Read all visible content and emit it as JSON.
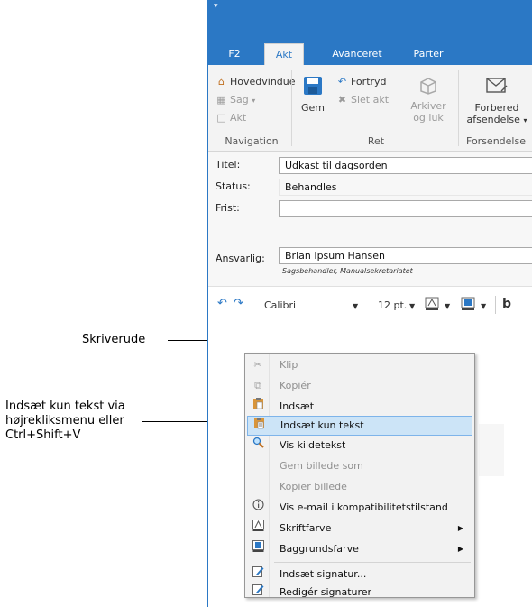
{
  "annotations": {
    "editor_label": "Skriverude",
    "paste_text_line1": "Indsæt kun tekst via",
    "paste_text_line2": "højrekliksmenu eller",
    "paste_text_line3": "Ctrl+Shift+V"
  },
  "tabs": [
    {
      "label": "F2",
      "active": false
    },
    {
      "label": "Akt",
      "active": true
    },
    {
      "label": "Avanceret",
      "active": false
    },
    {
      "label": "Parter",
      "active": false
    }
  ],
  "ribbon": {
    "navigation": {
      "items": [
        "Hovedvindue",
        "Sag",
        "Akt"
      ],
      "group_label": "Navigation"
    },
    "ret": {
      "save_line1": "Gem",
      "undo": "Fortryd",
      "delete": "Slet akt",
      "archive_line1": "Arkiver",
      "archive_line2": "og luk",
      "group_label": "Ret"
    },
    "send": {
      "prepare_line1": "Forbered",
      "prepare_line2": "afsendelse",
      "group_label": "Forsendelse"
    }
  },
  "form": {
    "title_label": "Titel:",
    "title_value": "Udkast til dagsorden",
    "status_label": "Status:",
    "status_value": "Behandles",
    "deadline_label": "Frist:",
    "deadline_value": "",
    "responsible_label": "Ansvarlig:",
    "responsible_value": "Brian Ipsum Hansen",
    "responsible_sub": "Sagsbehandler, Manualsekretariatet"
  },
  "format_toolbar": {
    "font": "Calibri",
    "size": "12 pt.",
    "bold": "b"
  },
  "context_menu": {
    "items": [
      {
        "label": "Klip",
        "enabled": false,
        "icon": "scissors-icon"
      },
      {
        "label": "Kopiér",
        "enabled": false,
        "icon": "copy-icon"
      },
      {
        "label": "Indsæt",
        "enabled": true,
        "icon": "paste-icon"
      },
      {
        "label": "Indsæt kun tekst",
        "enabled": true,
        "highlighted": true,
        "icon": "paste-text-icon"
      },
      {
        "label": "Vis kildetekst",
        "enabled": true,
        "icon": "magnifier-icon"
      },
      {
        "label": "Gem billede som",
        "enabled": false
      },
      {
        "label": "Kopier billede",
        "enabled": false
      },
      {
        "label": "Vis e-mail i kompatibilitetstilstand",
        "enabled": true,
        "icon": "info-icon"
      },
      {
        "label": "Skriftfarve",
        "enabled": true,
        "submenu": true,
        "icon": "font-color-icon"
      },
      {
        "label": "Baggrundsfarve",
        "enabled": true,
        "submenu": true,
        "icon": "background-color-icon"
      },
      {
        "label": "Indsæt signatur...",
        "enabled": true,
        "icon": "signature-icon"
      },
      {
        "label": "Redigér signaturer",
        "enabled": true,
        "icon": "edit-signature-icon"
      }
    ]
  },
  "colors": {
    "accent": "#2b78c5",
    "highlight": "#cce4f7"
  }
}
